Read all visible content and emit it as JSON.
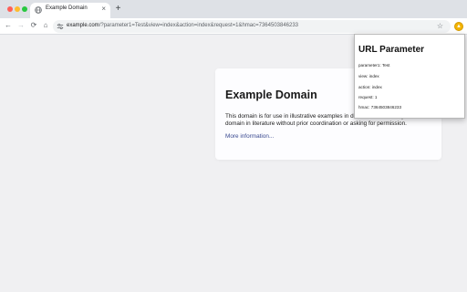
{
  "tab": {
    "title": "Example Domain",
    "close": "×",
    "new_tab": "+"
  },
  "toolbar": {
    "back": "←",
    "forward": "→",
    "reload": "⟳",
    "home": "⌂",
    "url_host": "example.com",
    "url_rest": "/?parameter1=Test&view=index&action=index&request=1&hmac=7364503846233",
    "star": "☆",
    "extension_icon": "shield-icon"
  },
  "page": {
    "title": "Example Domain",
    "body": "This domain is for use in illustrative examples in documents. You may use this domain in literature without prior coordination or asking for permission.",
    "link": "More information..."
  },
  "popup": {
    "title": "URL Parameter",
    "params": [
      "parameter1: Test",
      "view: index",
      "action: index",
      "request: 1",
      "hmac: 7364503846233"
    ]
  }
}
